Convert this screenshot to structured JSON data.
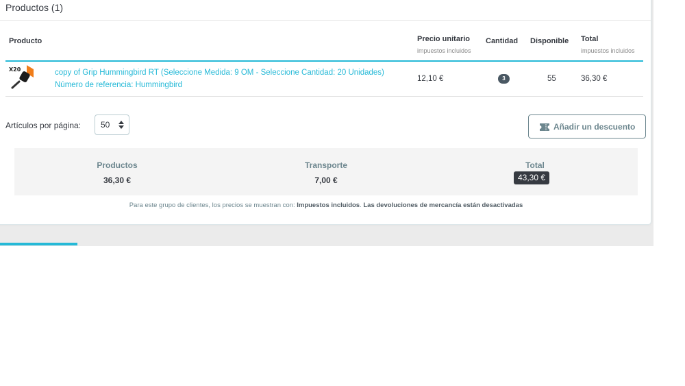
{
  "panel": {
    "title": "Productos (1)"
  },
  "table": {
    "columns": {
      "product": "Producto",
      "unit_price": "Precio unitario",
      "unit_price_sub": "impuestos incluidos",
      "quantity": "Cantidad",
      "available": "Disponible",
      "total": "Total",
      "total_sub": "impuestos incluidos"
    },
    "rows": [
      {
        "image_badge": "X20",
        "name": "copy of Grip Hummingbird RT (Seleccione Medida: 9 OM - Seleccione Cantidad: 20 Unidades)",
        "reference": "Número de referencia: Hummingbird",
        "unit_price": "12,10 €",
        "quantity": "3",
        "available": "55",
        "total": "36,30 €"
      }
    ]
  },
  "pagination": {
    "label": "Artículos por página:",
    "value": "50"
  },
  "discount_button": {
    "label": "Añadir un descuento",
    "icon": "ticket-icon"
  },
  "summary": {
    "products_label": "Productos",
    "products_value": "36,30 €",
    "shipping_label": "Transporte",
    "shipping_value": "7,00 €",
    "total_label": "Total",
    "total_value": "43,30 €"
  },
  "footnote": {
    "prefix": "Para este grupo de clientes, los precios se muestran con:",
    "tax_mode": "Impuestos incluidos",
    "separator": ".",
    "returns": "Las devoluciones de mercancía están desactivadas"
  },
  "colors": {
    "accent": "#25b9d7",
    "text": "#363a41",
    "muted": "#6c868e"
  }
}
